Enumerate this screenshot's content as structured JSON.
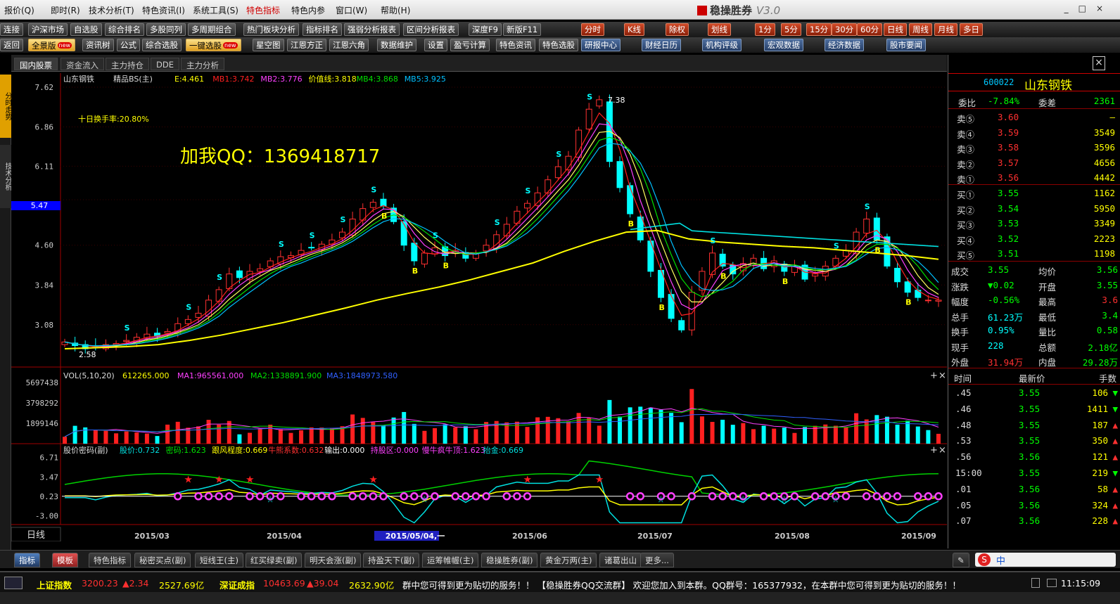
{
  "menu": {
    "items": [
      "报价(Q)",
      "即时(R)",
      "技术分析(T)",
      "特色资讯(I)",
      "系统工具(S)",
      "特色指标",
      "特色内参",
      "窗口(W)",
      "帮助(H)"
    ],
    "brand": "稳操胜券",
    "version": "V3.0",
    "window_controls": [
      "_",
      "□",
      "×"
    ]
  },
  "toolbar1": [
    "连接",
    "沪深市场",
    "自选股",
    "综合排名",
    "多股同列",
    "多周期组合",
    "热门板块分析",
    "指标排名",
    "强弱分析报表",
    "区间分析报表",
    "深度F9",
    "新版F11"
  ],
  "toolbar1_right": [
    "分时",
    "K线",
    "除权",
    "划线",
    "1分",
    "5分",
    "15分",
    "30分",
    "60分",
    "日线",
    "周线",
    "月线",
    "多日"
  ],
  "toolbar2": [
    "返回",
    "全景版",
    "资讯树",
    "公式",
    "综合选股",
    "一键选股",
    "星空图",
    "江恩方正",
    "江恩六角",
    "数据维护",
    "设置",
    "盈亏计算",
    "特色资讯",
    "特色选股",
    "研报中心",
    "财经日历",
    "机构评级",
    "宏观数据",
    "经济数据",
    "股市要闻"
  ],
  "new_badge": "new",
  "top_tabs": [
    "国内股票",
    "资金流入",
    "主力持仓",
    "DDE",
    "主力分析"
  ],
  "side_tabs": [
    "分时走势",
    "技术分析"
  ],
  "main_chart": {
    "title": "山东钢铁",
    "indicator": "精品BS(主)",
    "legend": [
      {
        "label": "E:4.461",
        "color": "#ffff00"
      },
      {
        "label": "MB1:3.742",
        "color": "#ff2020"
      },
      {
        "label": "MB2:3.776",
        "color": "#ff40ff"
      },
      {
        "label": "价值线:3.818",
        "color": "#ffff00"
      },
      {
        "label": "MB4:3.868",
        "color": "#00e000"
      },
      {
        "label": "MB5:3.925",
        "color": "#00c0ff"
      }
    ],
    "turnover_note": "十日换手率:20.80%",
    "ad_text": "加我QQ：1369418717",
    "price_marker": "5.47",
    "high_label": "7.38",
    "low_label": "2.58",
    "y_ticks": [
      "7.62",
      "6.86",
      "6.11",
      "5.47",
      "4.60",
      "3.84",
      "3.08"
    ]
  },
  "vol_chart": {
    "title": "VOL(5,10,20)",
    "value": "612265.000",
    "ma1": "MA1:965561.000",
    "ma2": "MA2:1338891.900",
    "ma3": "MA3:1848973.580",
    "y_ticks": [
      "5697438",
      "3798292",
      "1899146"
    ]
  },
  "ind_chart": {
    "title": "股价密码(副)",
    "labels": [
      {
        "t": "股价:0.732",
        "c": "#00e0e0"
      },
      {
        "t": "密码:1.623",
        "c": "#00e000"
      },
      {
        "t": "跟风程度:0.669",
        "c": "#ffff00"
      },
      {
        "t": "牛熊系数:0.632",
        "c": "#ff3030"
      },
      {
        "t": "输出:0.000",
        "c": "#ffffff"
      },
      {
        "t": "持股区:0.000",
        "c": "#ff40ff"
      },
      {
        "t": "慢牛疯牛顶:1.623",
        "c": "#ff40ff"
      },
      {
        "t": "抬金:0.669",
        "c": "#00e0e0"
      }
    ],
    "y_ticks": [
      "6.71",
      "3.47",
      "0.23",
      "-3.00"
    ]
  },
  "x_axis": {
    "period": "日线",
    "dates": [
      "2015/03",
      "2015/04",
      "2015/05/04,一",
      "2015/06",
      "2015/07",
      "2015/08",
      "2015/09"
    ]
  },
  "chart_data": {
    "type": "candlestick",
    "title": "山东钢铁",
    "ylim": [
      2.58,
      7.62
    ],
    "ohlc_closes": [
      2.75,
      2.68,
      2.62,
      2.66,
      2.7,
      2.72,
      2.78,
      2.84,
      2.9,
      2.86,
      2.95,
      3.1,
      3.18,
      3.3,
      3.55,
      3.75,
      4.05,
      3.98,
      4.1,
      4.15,
      4.3,
      4.38,
      4.4,
      4.5,
      4.55,
      4.62,
      4.7,
      4.85,
      5.1,
      5.3,
      5.42,
      5.35,
      5.05,
      4.6,
      4.3,
      4.45,
      4.55,
      4.4,
      4.5,
      4.35,
      4.45,
      4.6,
      4.8,
      5.0,
      5.25,
      5.4,
      5.6,
      5.85,
      6.1,
      6.3,
      6.8,
      7.2,
      7.38,
      6.2,
      5.7,
      5.2,
      4.7,
      4.1,
      3.6,
      3.2,
      2.98,
      3.7,
      4.1,
      4.45,
      4.2,
      4.05,
      4.25,
      4.35,
      4.15,
      4.3,
      4.1,
      4.2,
      3.95,
      4.05,
      4.2,
      4.35,
      4.5,
      4.85,
      5.1,
      4.7,
      4.2,
      3.9,
      3.7,
      3.6,
      3.55,
      3.55
    ],
    "ma_value_line": [
      2.62,
      2.64,
      2.66,
      2.7,
      2.78,
      2.88,
      3.0,
      3.12,
      3.26,
      3.4,
      3.55,
      3.68,
      3.8,
      3.94,
      4.1,
      4.26,
      4.48,
      4.68,
      4.85,
      4.88,
      4.72,
      4.66,
      4.62,
      4.58,
      4.55,
      4.5,
      4.45,
      4.4,
      4.33
    ],
    "volume_series_note": "daily volume bars with MA5/MA10/MA20",
    "volume_ylim": [
      0,
      5697438
    ]
  },
  "right_panel": {
    "code": "600022",
    "name": "山东钢铁",
    "weibi": {
      "label": "委比",
      "value": "-7.84%",
      "label2": "委差",
      "value2": "2361"
    },
    "asks": [
      {
        "label": "卖⑤",
        "price": "3.60",
        "vol": "—"
      },
      {
        "label": "卖④",
        "price": "3.59",
        "vol": "3549"
      },
      {
        "label": "卖③",
        "price": "3.58",
        "vol": "3596"
      },
      {
        "label": "卖②",
        "price": "3.57",
        "vol": "4656"
      },
      {
        "label": "卖①",
        "price": "3.56",
        "vol": "4442"
      }
    ],
    "bids": [
      {
        "label": "买①",
        "price": "3.55",
        "vol": "1162"
      },
      {
        "label": "买②",
        "price": "3.54",
        "vol": "5950"
      },
      {
        "label": "买③",
        "price": "3.53",
        "vol": "3349"
      },
      {
        "label": "买④",
        "price": "3.52",
        "vol": "2223"
      },
      {
        "label": "买⑤",
        "price": "3.51",
        "vol": "1198"
      }
    ],
    "stats": [
      {
        "l1": "成交",
        "v1": "3.55",
        "l2": "均价",
        "v2": "3.56"
      },
      {
        "l1": "涨跌",
        "v1": "▼0.02",
        "l2": "开盘",
        "v2": "3.55"
      },
      {
        "l1": "幅度",
        "v1": "-0.56%",
        "l2": "最高",
        "v2": "3.6"
      },
      {
        "l1": "总手",
        "v1": "61.23万",
        "l2": "最低",
        "v2": "3.4"
      },
      {
        "l1": "换手",
        "v1": "0.95%",
        "l2": "量比",
        "v2": "0.58"
      },
      {
        "l1": "现手",
        "v1": "228",
        "l2": "总额",
        "v2": "2.18亿"
      },
      {
        "l1": "外盘",
        "v1": "31.94万",
        "l2": "内盘",
        "v2": "29.28万"
      }
    ],
    "ticks_header": [
      "时间",
      "最新价",
      "手数"
    ],
    "ticks": [
      {
        "t": ".45",
        "p": "3.55",
        "v": "106",
        "d": "▼"
      },
      {
        "t": ".46",
        "p": "3.55",
        "v": "1411",
        "d": "▼"
      },
      {
        "t": ".48",
        "p": "3.55",
        "v": "187",
        "d": "▲"
      },
      {
        "t": ".53",
        "p": "3.55",
        "v": "350",
        "d": "▲"
      },
      {
        "t": ".56",
        "p": "3.56",
        "v": "121",
        "d": "▲"
      },
      {
        "t": "15:00",
        "p": "3.55",
        "v": "219",
        "d": "▼"
      },
      {
        "t": ".01",
        "p": "3.56",
        "v": "58",
        "d": "▲"
      },
      {
        "t": ".05",
        "p": "3.56",
        "v": "324",
        "d": "▲"
      },
      {
        "t": ".07",
        "p": "3.56",
        "v": "228",
        "d": "▲"
      }
    ]
  },
  "bottom_tabs": [
    "指标",
    "模板",
    "特色指标",
    "秘密买点(副)",
    "短线王(主)",
    "红买绿卖(副)",
    "明天会涨(副)",
    "持盈天下(副)",
    "运筹帷幄(主)",
    "稳操胜券(副)",
    "黄金万两(主)",
    "诸葛出山",
    "更多..."
  ],
  "ime": "中",
  "status": {
    "sh_label": "上证指数",
    "sh_value": "3200.23",
    "sh_change": "▲2.34",
    "sh_amount": "2527.69亿",
    "sz_label": "深证成指",
    "sz_value": "10463.69",
    "sz_change": "▲39.04",
    "sz_amount": "2632.90亿",
    "ticker": "群中您可得到更为贴切的服务！！   【稳操胜券QQ交流群】 欢迎您加入到本群。QQ群号：165377932，在本群中您可得到更为贴切的服务！！",
    "time": "11:15:09"
  }
}
